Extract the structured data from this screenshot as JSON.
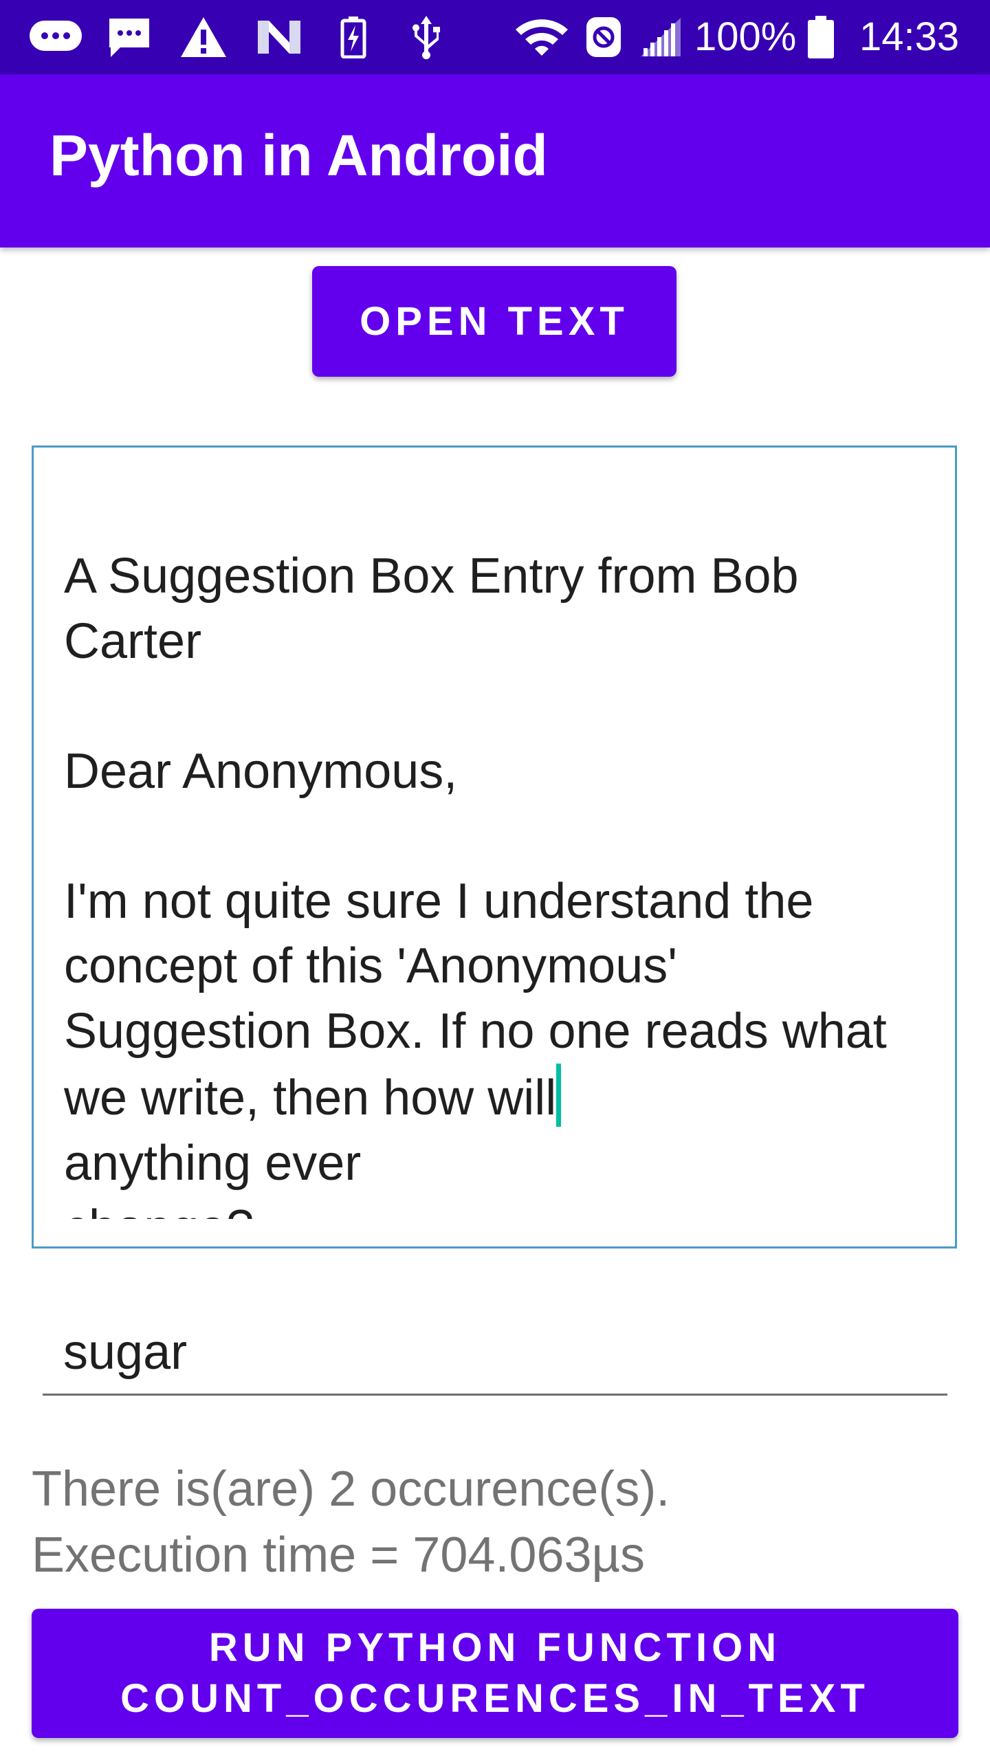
{
  "status_bar": {
    "icons": [
      "messenger-icon",
      "message-icon",
      "warning-icon",
      "n-app-icon",
      "battery-charging-icon",
      "usb-icon",
      "wifi-icon",
      "data-saver-icon",
      "signal-icon",
      "battery-icon"
    ],
    "battery_percent": "100%",
    "time": "14:33"
  },
  "app_bar": {
    "title": "Python in Android"
  },
  "open_button": {
    "label": "OPEN TEXT"
  },
  "text_box": {
    "before_caret": "A Suggestion Box Entry from Bob Carter\n\nDear Anonymous,\n\nI'm not quite sure I understand the concept of this 'Anonymous' Suggestion Box. If no one reads what we write, then how will",
    "after_caret": "\nanything ever\nchange?"
  },
  "search": {
    "value": "sugar"
  },
  "result": {
    "line1": "There is(are) 2 occurence(s).",
    "line2": "Execution time = 704.063µs"
  },
  "run_button": {
    "line1": "RUN PYTHON FUNCTION",
    "line2": "COUNT_OCCURENCES_IN_TEXT"
  },
  "colors": {
    "status_bar": "#3700b3",
    "primary": "#6200ee",
    "text_box_border": "#4a9cc7",
    "caret": "#00bfa5"
  }
}
